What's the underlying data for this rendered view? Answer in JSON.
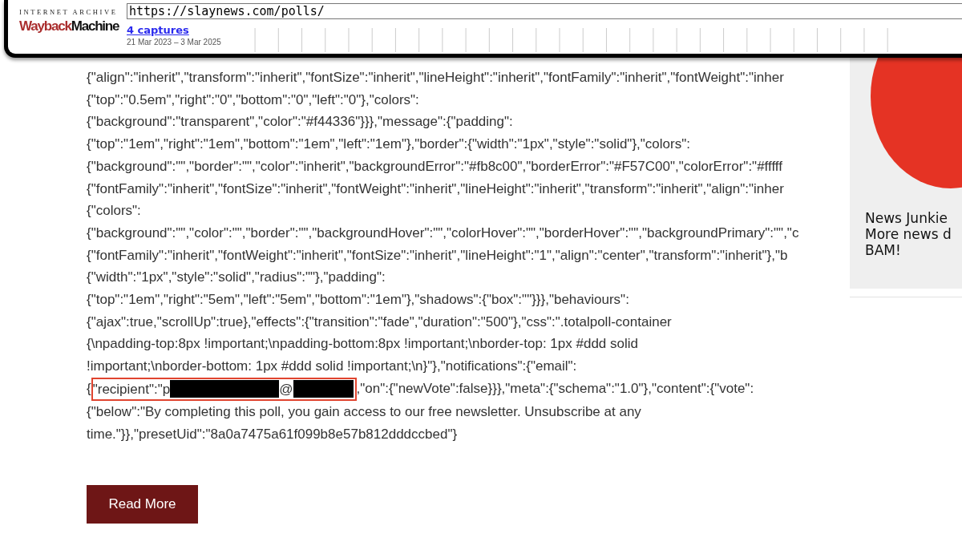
{
  "wayback": {
    "org": "INTERNET ARCHIVE",
    "logo_first": "Wayback",
    "logo_second": "Machine",
    "url": "https://slaynews.com/polls/",
    "captures": "4 captures",
    "date_range": "21 Mar 2023 – 3 Mar 2025"
  },
  "code_lines": [
    {
      "kind": "plain",
      "text": "{\"align\":\"inherit\",\"transform\":\"inherit\",\"fontSize\":\"inherit\",\"lineHeight\":\"inherit\",\"fontFamily\":\"inherit\",\"fontWeight\":\"inher"
    },
    {
      "kind": "plain",
      "text": "{\"top\":\"0.5em\",\"right\":\"0\",\"bottom\":\"0\",\"left\":\"0\"},\"colors\":"
    },
    {
      "kind": "plain",
      "text": "{\"background\":\"transparent\",\"color\":\"#f44336\"}}},\"message\":{\"padding\":"
    },
    {
      "kind": "plain",
      "text": "{\"top\":\"1em\",\"right\":\"1em\",\"bottom\":\"1em\",\"left\":\"1em\"},\"border\":{\"width\":\"1px\",\"style\":\"solid\"},\"colors\":"
    },
    {
      "kind": "plain",
      "text": "{\"background\":\"\",\"border\":\"\",\"color\":\"inherit\",\"backgroundError\":\"#fb8c00\",\"borderError\":\"#F57C00\",\"colorError\":\"#fffff"
    },
    {
      "kind": "plain",
      "text": "{\"fontFamily\":\"inherit\",\"fontSize\":\"inherit\",\"fontWeight\":\"inherit\",\"lineHeight\":\"inherit\",\"transform\":\"inherit\",\"align\":\"inher"
    },
    {
      "kind": "plain",
      "text": "{\"colors\":"
    },
    {
      "kind": "plain",
      "text": "{\"background\":\"\",\"color\":\"\",\"border\":\"\",\"backgroundHover\":\"\",\"colorHover\":\"\",\"borderHover\":\"\",\"backgroundPrimary\":\"\",\"c"
    },
    {
      "kind": "plain",
      "text": "{\"fontFamily\":\"inherit\",\"fontWeight\":\"inherit\",\"fontSize\":\"inherit\",\"lineHeight\":\"1\",\"align\":\"center\",\"transform\":\"inherit\"},\"b"
    },
    {
      "kind": "plain",
      "text": "{\"width\":\"1px\",\"style\":\"solid\",\"radius\":\"\"},\"padding\":"
    },
    {
      "kind": "plain",
      "text": "{\"top\":\"1em\",\"right\":\"5em\",\"left\":\"5em\",\"bottom\":\"1em\"},\"shadows\":{\"box\":\"\"}}},\"behaviours\":"
    },
    {
      "kind": "plain",
      "text": "{\"ajax\":true,\"scrollUp\":true},\"effects\":{\"transition\":\"fade\",\"duration\":\"500\"},\"css\":\".totalpoll-container"
    },
    {
      "kind": "plain",
      "text": "{\\npadding-top:8px !important;\\npadding-bottom:8px !important;\\nborder-top: 1px #ddd solid"
    },
    {
      "kind": "plain",
      "text": "!important;\\nborder-bottom: 1px #ddd solid !important;\\n}\"},\"notifications\":{\"email\":"
    },
    {
      "kind": "redacted",
      "before": "{",
      "boxed": "\"recipient\":\"p",
      "separator": "@",
      "after": ",\"on\":{\"newVote\":false}}},\"meta\":{\"schema\":\"1.0\"},\"content\":{\"vote\":"
    },
    {
      "kind": "plain",
      "text": "{\"below\":\"By completing this poll, you gain access to our free newsletter. Unsubscribe at any"
    },
    {
      "kind": "plain",
      "text": "time.\"}},\"presetUid\":\"8a0a7475a61f099b8e57b812dddccbed\"}"
    }
  ],
  "read_more": "Read More",
  "sidebar": {
    "lines": [
      "News Junkie",
      "More news d",
      "BAM!"
    ]
  }
}
